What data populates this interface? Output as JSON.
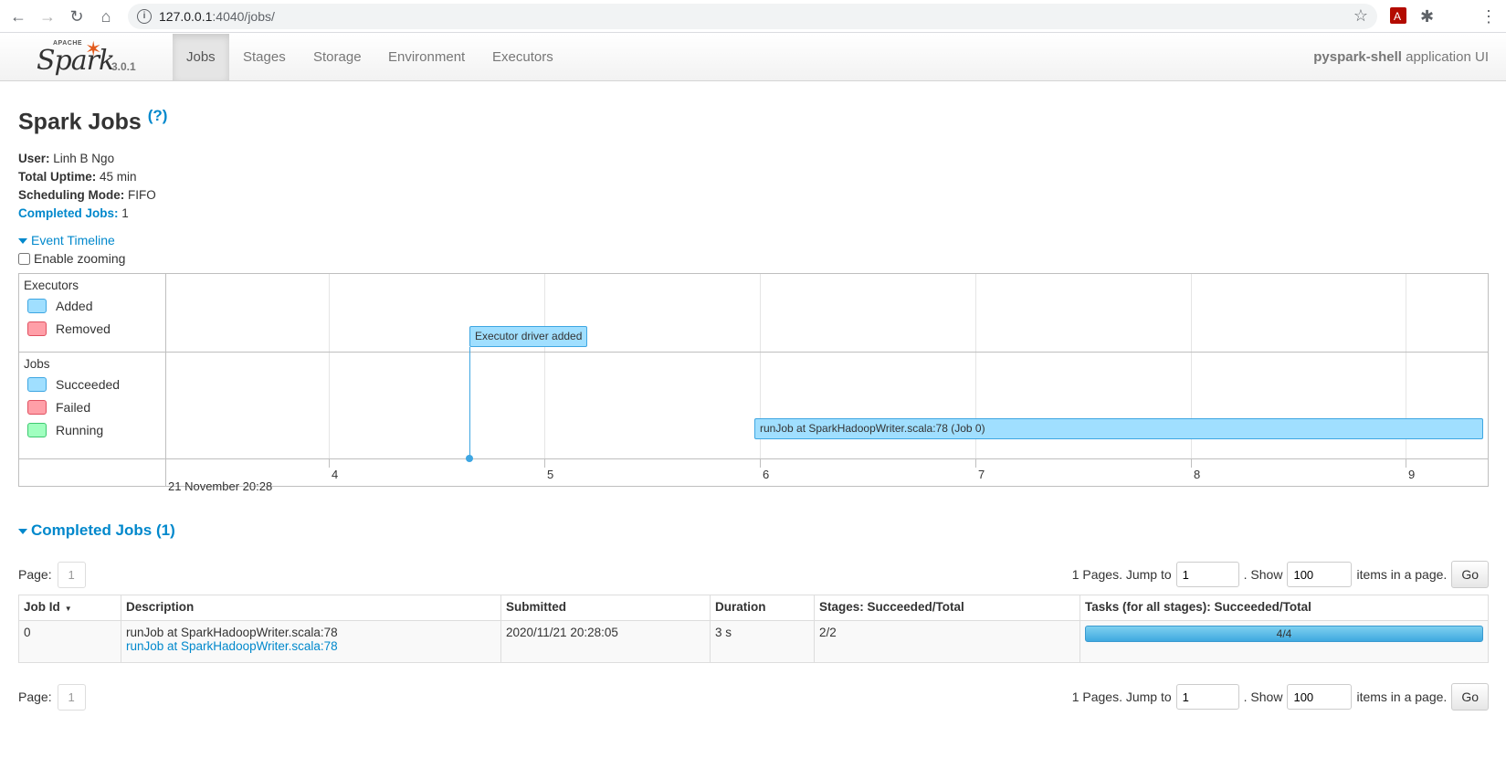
{
  "browser": {
    "url_host": "127.0.0.1",
    "url_path": ":4040/jobs/"
  },
  "navbar": {
    "logo_apache": "APACHE",
    "logo_spark": "Spark",
    "version": "3.0.1",
    "tabs": [
      {
        "label": "Jobs",
        "active": true
      },
      {
        "label": "Stages"
      },
      {
        "label": "Storage"
      },
      {
        "label": "Environment"
      },
      {
        "label": "Executors"
      }
    ],
    "app_name": "pyspark-shell",
    "app_suffix": "application UI"
  },
  "page": {
    "title": "Spark Jobs",
    "help": "(?)",
    "user_label": "User:",
    "user": "Linh B Ngo",
    "uptime_label": "Total Uptime:",
    "uptime": "45 min",
    "scheduling_label": "Scheduling Mode:",
    "scheduling": "FIFO",
    "completed_label": "Completed Jobs:",
    "completed": "1"
  },
  "timeline": {
    "toggle_label": "Event Timeline",
    "zoom_label": "Enable zooming",
    "executors_title": "Executors",
    "executors_legend": [
      "Added",
      "Removed"
    ],
    "jobs_title": "Jobs",
    "jobs_legend": [
      "Succeeded",
      "Failed",
      "Running"
    ],
    "ticks": [
      "4",
      "5",
      "6",
      "7",
      "8",
      "9"
    ],
    "date_label": "21 November 20:28",
    "executor_event": "Executor driver added",
    "job_event": "runJob at SparkHadoopWriter.scala:78 (Job 0)",
    "colors": {
      "added": "#a0dfff",
      "removed": "#ff9fa8",
      "running": "#a0ffbf"
    }
  },
  "completed_section": {
    "title": "Completed Jobs (1)"
  },
  "pager": {
    "page_label": "Page:",
    "page_value": "1",
    "pages_text": "1 Pages. Jump to",
    "jump_value": "1",
    "show_text": ". Show",
    "show_value": "100",
    "items_text": "items in a page.",
    "go_label": "Go"
  },
  "jobs_table": {
    "headers": [
      "Job Id",
      "Description",
      "Submitted",
      "Duration",
      "Stages: Succeeded/Total",
      "Tasks (for all stages): Succeeded/Total"
    ],
    "rows": [
      {
        "job_id": "0",
        "description": "runJob at SparkHadoopWriter.scala:78",
        "description_link": "runJob at SparkHadoopWriter.scala:78",
        "submitted": "2020/11/21 20:28:05",
        "duration": "3 s",
        "stages": "2/2",
        "tasks": "4/4",
        "tasks_progress": 1.0
      }
    ]
  }
}
